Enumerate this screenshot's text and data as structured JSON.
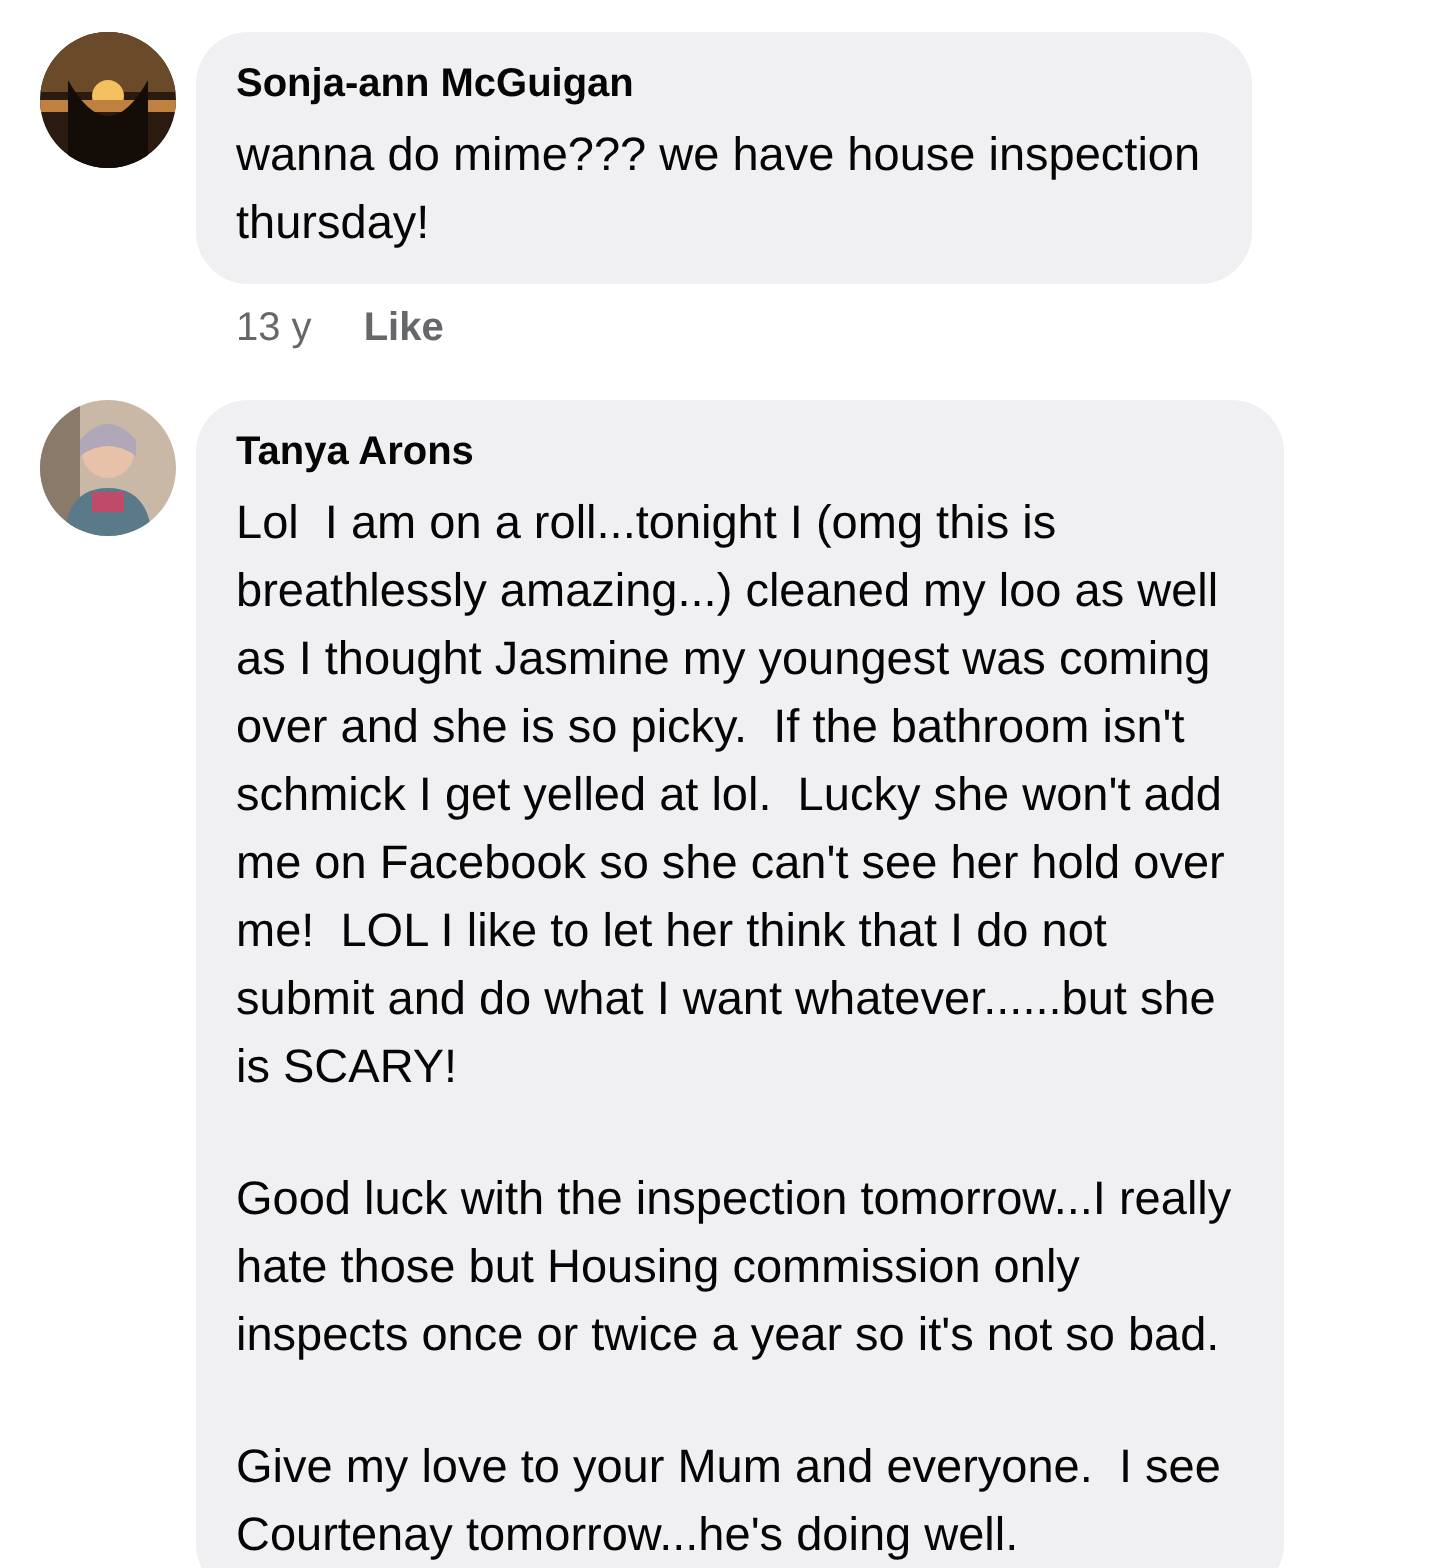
{
  "comments": [
    {
      "author": "Sonja-ann McGuigan",
      "avatar": {
        "kind": "picture"
      },
      "paragraphs": [
        [
          "wanna do mime??? we have house inspection",
          "thursday!"
        ]
      ],
      "time": "13 y",
      "action": "Like"
    },
    {
      "author": "Tanya Arons",
      "avatar": {
        "kind": "picture"
      },
      "paragraphs": [
        [
          "Lol  I am on a roll...tonight I (omg this is",
          "breathlessly amazing...) cleaned my loo as well",
          "as I thought Jasmine my youngest was coming",
          "over and she is so picky.  If the bathroom isn't",
          "schmick I get yelled at lol.  Lucky she won't add",
          "me on Facebook so she can't see her hold over",
          "me!  LOL I like to let her think that I do not",
          "submit and do what I want whatever......but she",
          "is SCARY!"
        ],
        [
          "Good luck with the inspection tomorrow...I really",
          "hate those but Housing commission only",
          "inspects once or twice a year so it's not so bad."
        ],
        [
          "Give my love to your Mum and everyone.  I see",
          "Courtenay tomorrow...he's doing well."
        ]
      ]
    }
  ]
}
